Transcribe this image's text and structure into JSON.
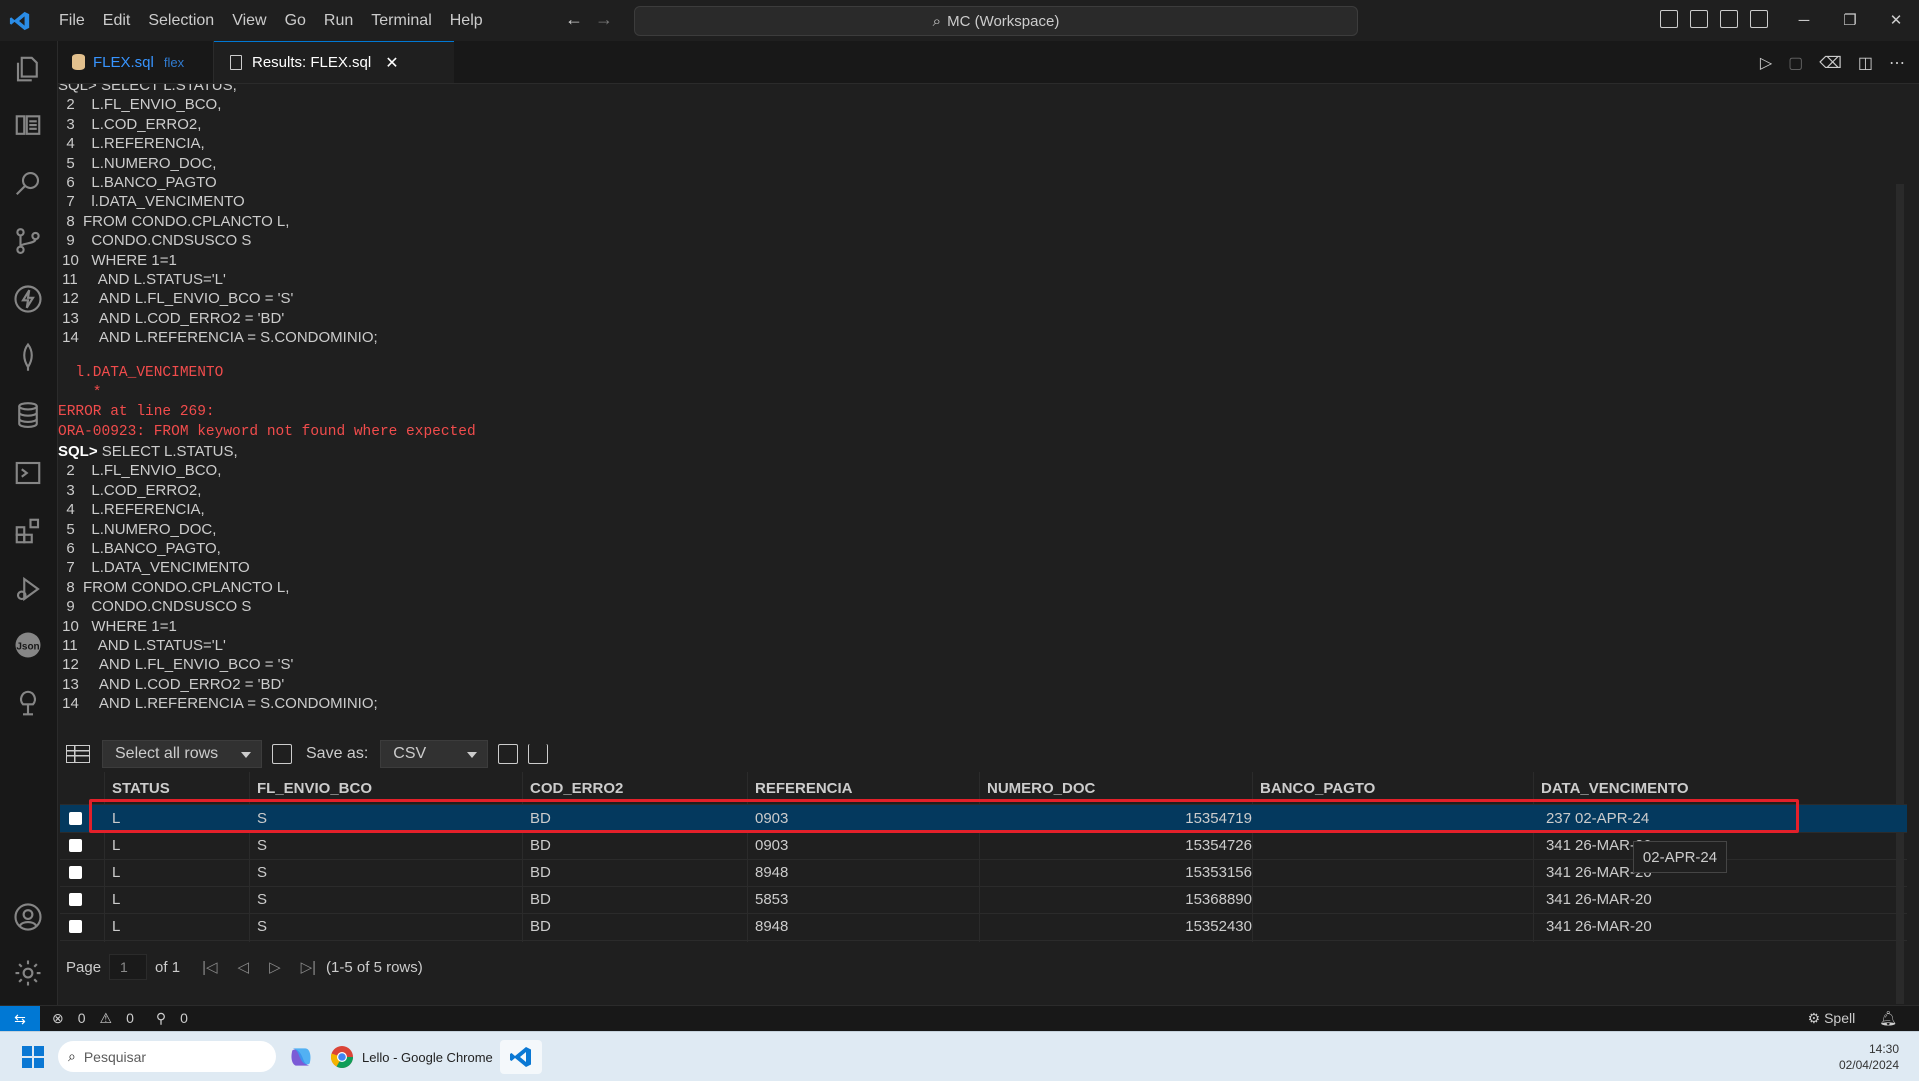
{
  "menu": [
    "File",
    "Edit",
    "Selection",
    "View",
    "Go",
    "Run",
    "Terminal",
    "Help"
  ],
  "command_center": "MC (Workspace)",
  "tabs": [
    {
      "name": "FLEX.sql",
      "description": "flex"
    },
    {
      "name": "Results: FLEX.sql",
      "close": "✕"
    }
  ],
  "code_lines": [
    "SQL> SELECT L.STATUS,",
    "  2    L.FL_ENVIO_BCO,",
    "  3    L.COD_ERRO2,",
    "  4    L.REFERENCIA,",
    "  5    L.NUMERO_DOC,",
    "  6    L.BANCO_PAGTO",
    "  7    l.DATA_VENCIMENTO",
    "  8  FROM CONDO.CPLANCTO L,",
    "  9    CONDO.CNDSUSCO S",
    " 10   WHERE 1=1",
    " 11     AND L.STATUS='L'",
    " 12     AND L.FL_ENVIO_BCO = 'S'",
    " 13     AND L.COD_ERRO2 = 'BD'",
    " 14     AND L.REFERENCIA = S.CONDOMINIO;"
  ],
  "error_lines": [
    "  l.DATA_VENCIMENTO",
    "    *",
    "ERROR at line 269:",
    "ORA-00923: FROM keyword not found where expected"
  ],
  "code_lines_2": [
    "SELECT L.STATUS,",
    "  2    L.FL_ENVIO_BCO,",
    "  3    L.COD_ERRO2,",
    "  4    L.REFERENCIA,",
    "  5    L.NUMERO_DOC,",
    "  6    L.BANCO_PAGTO,",
    "  7    L.DATA_VENCIMENTO",
    "  8  FROM CONDO.CPLANCTO L,",
    "  9    CONDO.CNDSUSCO S",
    " 10   WHERE 1=1",
    " 11     AND L.STATUS='L'",
    " 12     AND L.FL_ENVIO_BCO = 'S'",
    " 13     AND L.COD_ERRO2 = 'BD'",
    " 14     AND L.REFERENCIA = S.CONDOMINIO;"
  ],
  "sql_prompt": "SQL>",
  "toolbar": {
    "select_rows": "Select all rows",
    "save_as_label": "Save as:",
    "format": "CSV"
  },
  "table": {
    "columns": [
      "STATUS",
      "FL_ENVIO_BCO",
      "COD_ERRO2",
      "REFERENCIA",
      "NUMERO_DOC",
      "BANCO_PAGTO",
      "DATA_VENCIMENTO"
    ],
    "rows": [
      [
        "L",
        "S",
        "BD",
        "0903",
        "15354719",
        "237",
        "02-APR-24"
      ],
      [
        "L",
        "S",
        "BD",
        "0903",
        "15354726",
        "341",
        "26-MAR-20"
      ],
      [
        "L",
        "S",
        "BD",
        "8948",
        "15353156",
        "341",
        "26-MAR-20"
      ],
      [
        "L",
        "S",
        "BD",
        "5853",
        "15368890",
        "341",
        "26-MAR-20"
      ],
      [
        "L",
        "S",
        "BD",
        "8948",
        "15352430",
        "341",
        "26-MAR-20"
      ]
    ]
  },
  "tooltip": "02-APR-24",
  "pager": {
    "page_label": "Page",
    "page_value": "1",
    "of_label": "of 1",
    "summary": "(1-5 of 5 rows)"
  },
  "status": {
    "errors": "0",
    "warnings": "0",
    "ports": "0",
    "spell": "Spell"
  },
  "taskbar": {
    "search": "Pesquisar",
    "chrome": "Lello - Google Chrome",
    "time": "14:30",
    "date": "02/04/2024"
  }
}
